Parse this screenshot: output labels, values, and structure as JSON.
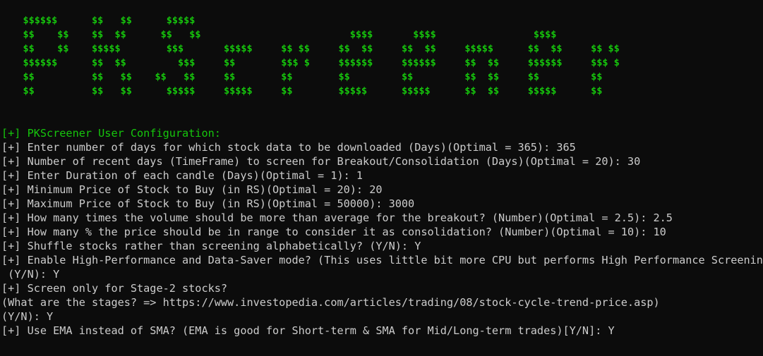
{
  "banner": {
    "lines": [
      "    $$$$$$      $$   $$      $$$$$",
      "    $$    $$    $$  $$      $$   $$                          $$$$       $$$$                 $$$$",
      "    $$    $$    $$$$$        $$$       $$$$$     $$ $$     $$  $$     $$  $$     $$$$$      $$  $$     $$ $$",
      "    $$$$$$      $$  $$         $$$     $$        $$$ $     $$$$$$     $$$$$$     $$  $$     $$$$$$     $$$ $",
      "    $$          $$   $$    $$   $$     $$        $$        $$         $$         $$  $$     $$         $$",
      "    $$          $$   $$      $$$$$     $$$$$     $$        $$$$$      $$$$$      $$  $$     $$$$$      $$"
    ]
  },
  "terminal": {
    "header": "[+] PKScreener User Configuration:",
    "prompts": [
      "[+] Enter number of days for which stock data to be downloaded (Days)(Optimal = 365): 365",
      "[+] Number of recent days (TimeFrame) to screen for Breakout/Consolidation (Days)(Optimal = 20): 30",
      "[+] Enter Duration of each candle (Days)(Optimal = 1): 1",
      "[+] Minimum Price of Stock to Buy (in RS)(Optimal = 20): 20",
      "[+] Maximum Price of Stock to Buy (in RS)(Optimal = 50000): 3000",
      "[+] How many times the volume should be more than average for the breakout? (Number)(Optimal = 2.5): 2.5",
      "[+] How many % the price should be in range to consider it as consolidation? (Number)(Optimal = 10): 10",
      "[+] Shuffle stocks rather than screening alphabetically? (Y/N): Y",
      "[+] Enable High-Performance and Data-Saver mode? (This uses little bit more CPU but performs High Performance Screening)",
      " (Y/N): Y",
      "[+] Screen only for Stage-2 stocks?",
      "(What are the stages? => https://www.investopedia.com/articles/trading/08/stock-cycle-trend-price.asp)",
      "(Y/N): Y",
      "[+] Use EMA instead of SMA? (EMA is good for Short-term & SMA for Mid/Long-term trades)[Y/N]: Y"
    ]
  },
  "colors": {
    "background": "#0c0c0c",
    "text": "#cccccc",
    "accent_green": "#16c60c"
  }
}
